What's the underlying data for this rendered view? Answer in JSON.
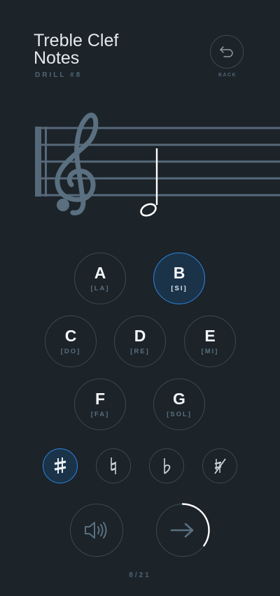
{
  "header": {
    "title_line1": "Treble Clef",
    "title_line2": "Notes",
    "subtitle": "DRILL #8",
    "back_label": "BACK",
    "back_icon": "undo-arrow-icon"
  },
  "staff": {
    "clef": "treble-clef-icon",
    "note_icon": "half-note-icon"
  },
  "notes": [
    {
      "letter": "A",
      "solfege": "[LA]",
      "selected": false
    },
    {
      "letter": "B",
      "solfege": "[SI]",
      "selected": true
    },
    {
      "letter": "C",
      "solfege": "[DO]",
      "selected": false
    },
    {
      "letter": "D",
      "solfege": "[RE]",
      "selected": false
    },
    {
      "letter": "E",
      "solfege": "[MI]",
      "selected": false
    },
    {
      "letter": "F",
      "solfege": "[FA]",
      "selected": false
    },
    {
      "letter": "G",
      "solfege": "[SOL]",
      "selected": false
    }
  ],
  "accidentals": [
    {
      "icon": "sharp-icon",
      "selected": true
    },
    {
      "icon": "natural-icon",
      "selected": false
    },
    {
      "icon": "flat-icon",
      "selected": false
    },
    {
      "icon": "no-accidental-icon",
      "selected": false
    }
  ],
  "controls": {
    "sound_icon": "speaker-icon",
    "next_icon": "arrow-right-icon",
    "timer_remaining": 0.35
  },
  "progress": {
    "text": "8/21",
    "current": 8,
    "total": 21
  },
  "colors": {
    "background": "#1c2329",
    "accent": "#2a86e0",
    "staff": "#5a7080",
    "muted": "#4f6573"
  }
}
